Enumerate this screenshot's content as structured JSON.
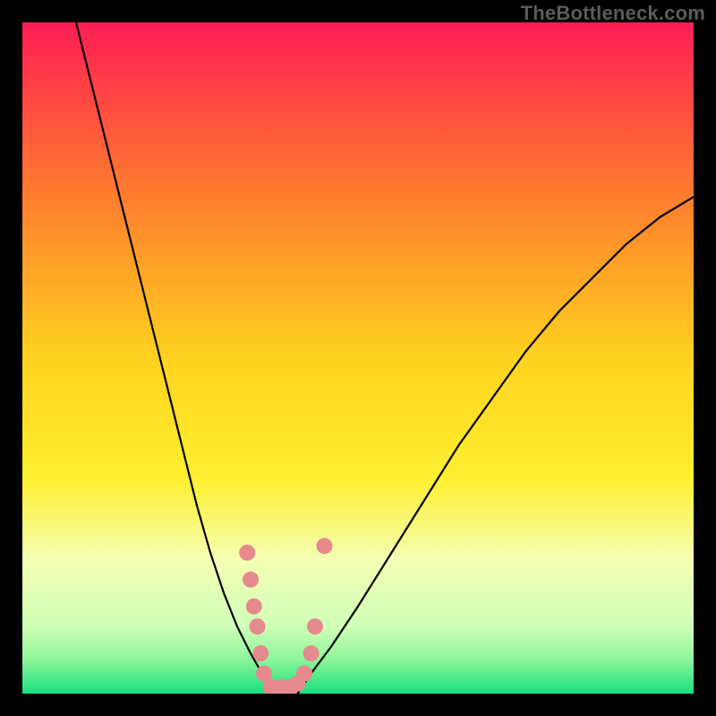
{
  "watermark": "TheBottleneck.com",
  "chart_data": {
    "type": "line",
    "title": "",
    "xlabel": "",
    "ylabel": "",
    "xlim": [
      0,
      100
    ],
    "ylim": [
      0,
      100
    ],
    "grid": false,
    "legend": false,
    "background_gradient_stops": [
      {
        "offset": 0,
        "color": "#ff1d54"
      },
      {
        "offset": 25,
        "color": "#ff7a2f"
      },
      {
        "offset": 50,
        "color": "#ffd21f"
      },
      {
        "offset": 68,
        "color": "#fff030"
      },
      {
        "offset": 80,
        "color": "#f4ffb3"
      },
      {
        "offset": 90,
        "color": "#d0ffb8"
      },
      {
        "offset": 95,
        "color": "#8cf59a"
      },
      {
        "offset": 100,
        "color": "#16e07d"
      }
    ],
    "series": [
      {
        "name": "left-curve",
        "stroke": "#000000",
        "stroke_width": 2.2,
        "x": [
          8,
          10,
          12,
          14,
          16,
          18,
          20,
          22,
          24,
          26,
          28,
          30,
          32,
          34,
          36,
          37
        ],
        "y": [
          100,
          92,
          84,
          76,
          68,
          60,
          52,
          44,
          36,
          28,
          21,
          15,
          10,
          6,
          2.5,
          0
        ]
      },
      {
        "name": "right-curve",
        "stroke": "#000000",
        "stroke_width": 2.2,
        "x": [
          41,
          43,
          46,
          50,
          55,
          60,
          65,
          70,
          75,
          80,
          85,
          90,
          95,
          100
        ],
        "y": [
          0,
          3,
          7,
          13,
          21,
          29,
          37,
          44,
          51,
          57,
          62,
          67,
          71,
          74
        ]
      }
    ],
    "markers": [
      {
        "name": "highlight-dots",
        "fill": "#e68a8e",
        "radius_px": 9,
        "points": [
          {
            "x": 33.5,
            "y": 21
          },
          {
            "x": 34.0,
            "y": 17
          },
          {
            "x": 34.5,
            "y": 13
          },
          {
            "x": 35.0,
            "y": 10
          },
          {
            "x": 35.5,
            "y": 6
          },
          {
            "x": 36.0,
            "y": 3
          },
          {
            "x": 37.0,
            "y": 1
          },
          {
            "x": 38.5,
            "y": 1
          },
          {
            "x": 40.0,
            "y": 1
          },
          {
            "x": 41.0,
            "y": 1.5
          },
          {
            "x": 42.0,
            "y": 3
          },
          {
            "x": 43.0,
            "y": 6
          },
          {
            "x": 43.6,
            "y": 10
          },
          {
            "x": 45.0,
            "y": 22
          }
        ]
      }
    ]
  }
}
